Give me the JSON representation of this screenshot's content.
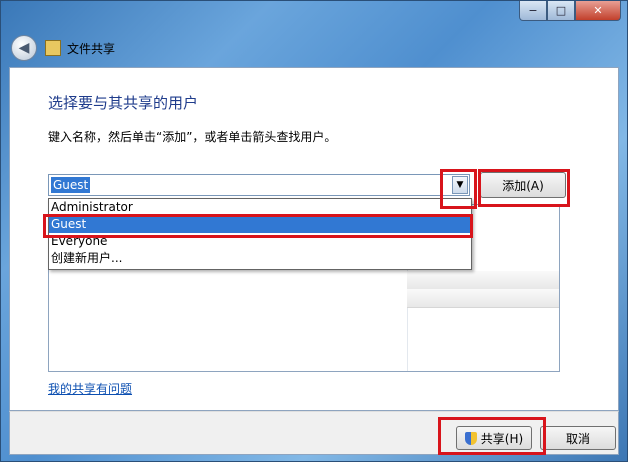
{
  "window": {
    "title": "文件共享",
    "controls": {
      "minimize": "−",
      "maximize": "□",
      "close": "✕"
    }
  },
  "nav": {
    "back_icon": "back-arrow-icon",
    "title_icon": "file-share-icon"
  },
  "main": {
    "heading": "选择要与其共享的用户",
    "instruction": "键入名称，然后单击“添加”，或者单击箭头查找用户。",
    "combo_value": "Guest",
    "add_button": "添加(A)",
    "dropdown_items": [
      "Administrator",
      "Guest",
      "Everyone",
      "创建新用户..."
    ],
    "selected_item": "Guest",
    "help_link": "我的共享有问题"
  },
  "footer": {
    "share_button": "共享(H)",
    "cancel_button": "取消"
  },
  "colors": {
    "highlight": "#d8141b",
    "selection": "#3178d3",
    "heading": "#1f3c8c"
  }
}
